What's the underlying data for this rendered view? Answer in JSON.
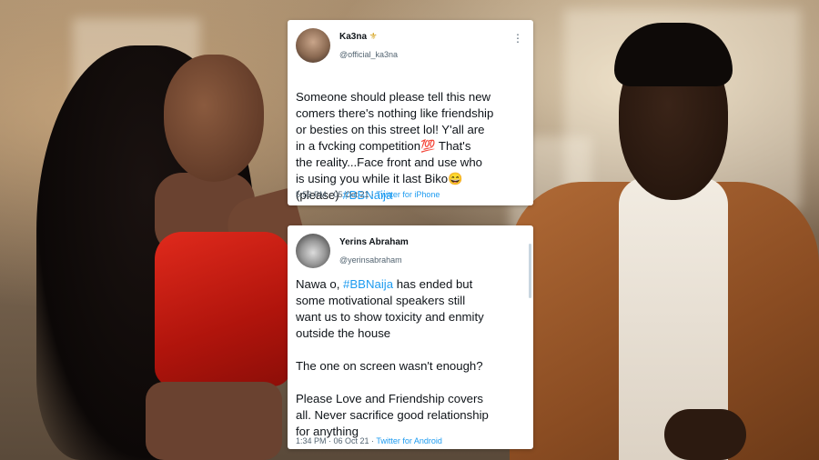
{
  "tweets": [
    {
      "name": "Ka3na",
      "name_symbol": "⚜",
      "handle": "@official_ka3na",
      "more": "⋮",
      "body_lines": [
        "Someone should please tell this new",
        "comers there's nothing like friendship",
        "or besties on this street lol! Y'all are",
        "in a fvcking competition💯 That's",
        "the reality...Face front and use who",
        "is using you while it last Biko😄",
        "(please) "
      ],
      "hashtag": "#BBNaija",
      "time": "5:56 PM · 05 Oct 21 · ",
      "source": "Twitter for iPhone"
    },
    {
      "name": "Yerins Abraham",
      "handle": "@yerinsabraham",
      "more": "⋮",
      "body_prefix": "Nawa o, ",
      "hashtag": "#BBNaija",
      "body_lines": [
        " has ended but",
        "some motivational speakers still",
        "want us to show toxicity and enmity",
        "outside the house",
        "",
        "The one on screen wasn't enough?",
        "",
        "Please Love and Friendship covers",
        "all. Never sacrifice good relationship",
        "for anything"
      ],
      "time": "1:34 PM · 06 Oct 21 · ",
      "source": "Twitter for Android"
    }
  ],
  "colors": {
    "link": "#1d9bf0",
    "text": "#0f1419",
    "muted": "#536471"
  }
}
